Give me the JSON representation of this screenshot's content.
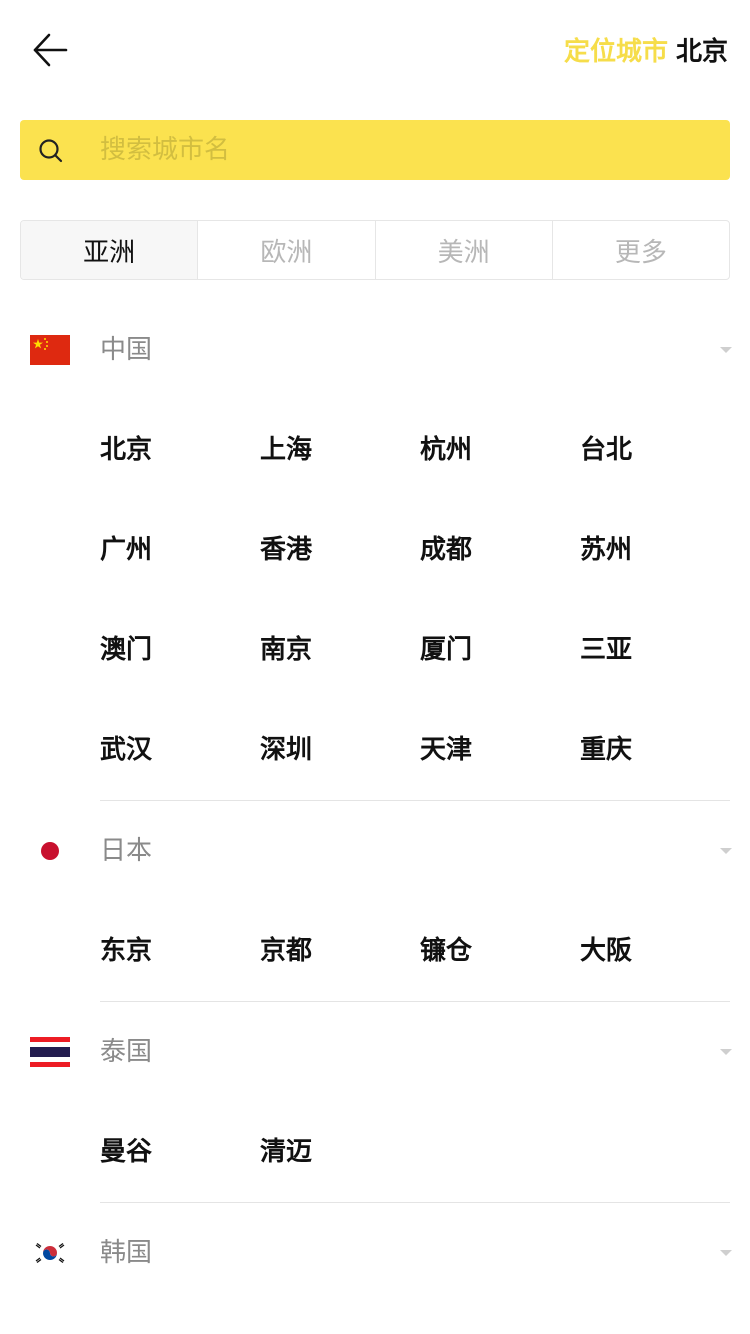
{
  "header": {
    "location_label": "定位城市",
    "location_city": "北京"
  },
  "search": {
    "placeholder": "搜索城市名"
  },
  "tabs": [
    {
      "label": "亚洲"
    },
    {
      "label": "欧洲"
    },
    {
      "label": "美洲"
    },
    {
      "label": "更多"
    }
  ],
  "countries": [
    {
      "name": "中国",
      "flag": "china-flag",
      "cities": [
        "北京",
        "上海",
        "杭州",
        "台北",
        "广州",
        "香港",
        "成都",
        "苏州",
        "澳门",
        "南京",
        "厦门",
        "三亚",
        "武汉",
        "深圳",
        "天津",
        "重庆"
      ]
    },
    {
      "name": "日本",
      "flag": "japan-flag",
      "cities": [
        "东京",
        "京都",
        "镰仓",
        "大阪"
      ]
    },
    {
      "name": "泰国",
      "flag": "thailand-flag",
      "cities": [
        "曼谷",
        "清迈"
      ]
    },
    {
      "name": "韩国",
      "flag": "korea-flag",
      "cities": []
    }
  ],
  "colors": {
    "accent": "#fbe24f",
    "location_label": "#f6dd4a"
  }
}
